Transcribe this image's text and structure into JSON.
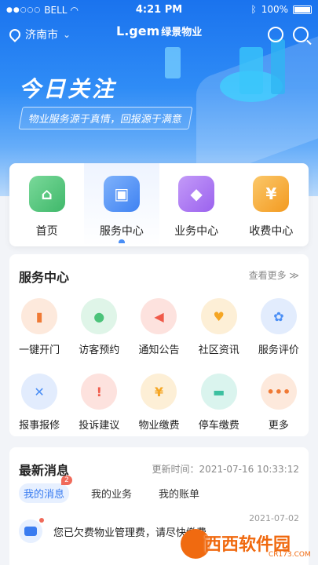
{
  "status_bar": {
    "carrier": "BELL",
    "time": "4:21 PM",
    "battery": "100%"
  },
  "header": {
    "city": "济南市",
    "logo": "L.gem",
    "logo_cn": "绿景物业"
  },
  "hero": {
    "title": "今日关注",
    "subtitle": "物业服务源于真情，回报源于满意"
  },
  "quick_nav": [
    {
      "label": "首页",
      "color": "#4cc37a",
      "icon": "home-icon"
    },
    {
      "label": "服务中心",
      "color": "#4a8ef5",
      "icon": "briefcase-icon"
    },
    {
      "label": "业务中心",
      "color": "#a56ef2",
      "icon": "grid-icon"
    },
    {
      "label": "收费中心",
      "color": "#f5a623",
      "icon": "yuan-icon"
    }
  ],
  "service_center": {
    "title": "服务中心",
    "more": "查看更多 ≫",
    "items": [
      {
        "label": "一键开门",
        "color": "#f07a35",
        "icon": "door-icon"
      },
      {
        "label": "访客预约",
        "color": "#4cc37a",
        "icon": "visitor-icon"
      },
      {
        "label": "通知公告",
        "color": "#f05a4a",
        "icon": "megaphone-icon"
      },
      {
        "label": "社区资讯",
        "color": "#f5a623",
        "icon": "house-heart-icon"
      },
      {
        "label": "服务评价",
        "color": "#4a8ef5",
        "icon": "flower-icon"
      },
      {
        "label": "报事报修",
        "color": "#4a8ef5",
        "icon": "tools-icon"
      },
      {
        "label": "投诉建议",
        "color": "#f05a4a",
        "icon": "complaint-icon"
      },
      {
        "label": "物业缴费",
        "color": "#f5a623",
        "icon": "bill-icon"
      },
      {
        "label": "停车缴费",
        "color": "#3cc0a0",
        "icon": "car-icon"
      },
      {
        "label": "更多",
        "color": "#f07a35",
        "icon": "more-icon"
      }
    ]
  },
  "news": {
    "title": "最新消息",
    "updated": "更新时间：2021-07-16  10:33:12",
    "tabs": [
      "我的消息",
      "我的业务",
      "我的账单"
    ],
    "badge": "2",
    "message": {
      "text": "您已欠费物业管理费，请尽快缴费",
      "date": "2021-07-02"
    }
  },
  "watermark": {
    "text": "西西软件园",
    "sub": "CR173.COM"
  }
}
